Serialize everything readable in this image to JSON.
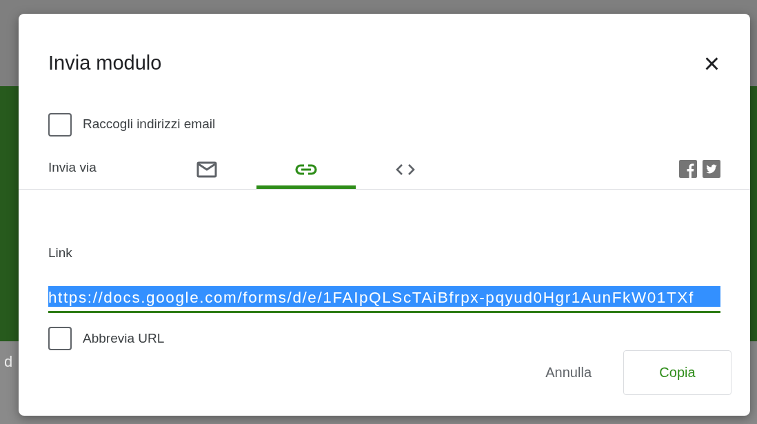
{
  "background_text": "d",
  "dialog": {
    "title": "Invia modulo",
    "close": "×",
    "collect_emails": {
      "label": "Raccogli indirizzi email",
      "checked": false
    },
    "send_via": {
      "label": "Invia via",
      "tabs": [
        {
          "kind": "email",
          "selected": false
        },
        {
          "kind": "link",
          "selected": true
        },
        {
          "kind": "embed",
          "selected": false
        }
      ]
    },
    "link": {
      "label": "Link",
      "value": "https://docs.google.com/forms/d/e/1FAIpQLScTAiBfrpx-pqyud0Hgr1AunFkW01TXf",
      "highlighted": true
    },
    "shorten_url": {
      "label": "Abbrevia URL",
      "checked": false
    },
    "buttons": [
      {
        "label": "Annulla",
        "kind": "text"
      },
      {
        "label": "Copia",
        "kind": "outlined"
      }
    ]
  }
}
